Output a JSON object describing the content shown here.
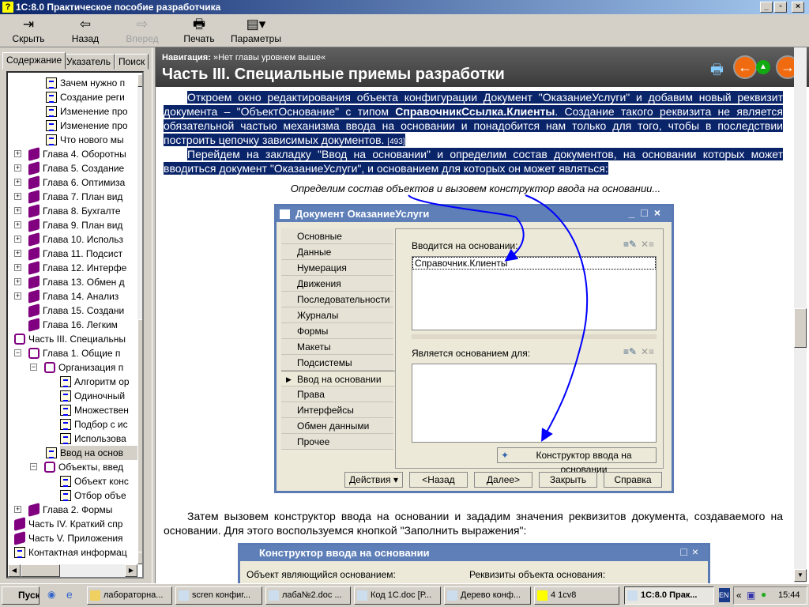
{
  "window": {
    "title": "1С:8.0  Практическое пособие разработчика"
  },
  "toolbar": [
    {
      "label": "Скрыть",
      "icon": "hide-icon"
    },
    {
      "label": "Назад",
      "icon": "back-arrow-icon"
    },
    {
      "label": "Вперед",
      "icon": "forward-arrow-icon",
      "disabled": true
    },
    {
      "label": "Печать",
      "icon": "printer-icon"
    },
    {
      "label": "Параметры",
      "icon": "options-icon"
    }
  ],
  "tabs": [
    "Содержание",
    "Указатель",
    "Поиск"
  ],
  "tree": [
    {
      "label": "Зачем нужно п",
      "type": "doc",
      "lvl": 3
    },
    {
      "label": "Создание реги",
      "type": "doc",
      "lvl": 3
    },
    {
      "label": "Изменение про",
      "type": "doc",
      "lvl": 3
    },
    {
      "label": "Изменение про",
      "type": "doc",
      "lvl": 3
    },
    {
      "label": "Что нового мы",
      "type": "doc",
      "lvl": 3
    },
    {
      "label": "Глава 4. Оборотны",
      "type": "book",
      "lvl": 1,
      "pm": "+"
    },
    {
      "label": "Глава 5. Создание",
      "type": "book",
      "lvl": 1,
      "pm": "+"
    },
    {
      "label": "Глава 6. Оптимиза",
      "type": "book",
      "lvl": 1,
      "pm": "+"
    },
    {
      "label": "Глава 7. План вид",
      "type": "book",
      "lvl": 1,
      "pm": "+"
    },
    {
      "label": "Глава 8. Бухгалте",
      "type": "book",
      "lvl": 1,
      "pm": "+"
    },
    {
      "label": "Глава 9. План вид",
      "type": "book",
      "lvl": 1,
      "pm": "+"
    },
    {
      "label": "Глава 10. Использ",
      "type": "book",
      "lvl": 1,
      "pm": "+"
    },
    {
      "label": "Глава 11. Подсист",
      "type": "book",
      "lvl": 1,
      "pm": "+"
    },
    {
      "label": "Глава 12. Интерфе",
      "type": "book",
      "lvl": 1,
      "pm": "+"
    },
    {
      "label": "Глава 13. Обмен д",
      "type": "book",
      "lvl": 1,
      "pm": "+"
    },
    {
      "label": "Глава 14. Анализ",
      "type": "book",
      "lvl": 1,
      "pm": "+"
    },
    {
      "label": "Глава 15. Создани",
      "type": "book",
      "lvl": 1
    },
    {
      "label": "Глава 16. Легким",
      "type": "book",
      "lvl": 1
    },
    {
      "label": "Часть III. Специальны",
      "type": "obook",
      "lvl": 0
    },
    {
      "label": "Глава 1. Общие п",
      "type": "obook",
      "lvl": 1,
      "pm": "−"
    },
    {
      "label": "Организация п",
      "type": "obook",
      "lvl": 2,
      "pm": "−"
    },
    {
      "label": "Алгоритм ор",
      "type": "doc",
      "lvl": 4
    },
    {
      "label": "Одиночный",
      "type": "doc",
      "lvl": 4
    },
    {
      "label": "Множествен",
      "type": "doc",
      "lvl": 4
    },
    {
      "label": "Подбор с ис",
      "type": "doc",
      "lvl": 4
    },
    {
      "label": "Использова",
      "type": "doc",
      "lvl": 4
    },
    {
      "label": "Ввод на основ",
      "type": "doc",
      "lvl": 3,
      "selected": true
    },
    {
      "label": "Объекты, введ",
      "type": "obook",
      "lvl": 2,
      "pm": "−"
    },
    {
      "label": "Объект конс",
      "type": "doc",
      "lvl": 4
    },
    {
      "label": "Отбор объе",
      "type": "doc",
      "lvl": 4
    },
    {
      "label": "Глава 2. Формы",
      "type": "book",
      "lvl": 1,
      "pm": "+"
    },
    {
      "label": "Часть IV. Краткий спр",
      "type": "book",
      "lvl": 0
    },
    {
      "label": "Часть V. Приложения",
      "type": "book",
      "lvl": 0
    },
    {
      "label": "Контактная информац",
      "type": "mail",
      "lvl": 0
    }
  ],
  "header": {
    "nav_label": "Навигация:",
    "nav_value": "»Нет главы уровнем выше«",
    "title": "Часть III. Специальные приемы разработки"
  },
  "content": {
    "p1a": "Откроем окно редактирования объекта конфигурации Документ \"ОказаниеУслуги\" и добавим новый реквизит документа – \"ОбъектОснование\" с типом ",
    "p1b": "СправочникСсылка.Клиенты",
    "p1c": ". Создание такого реквизита не является обязательной частью механизма ввода на основании и понадобится нам только для того, чтобы в последствии построить цепочку зависимых документов.",
    "p1ref": "[493]",
    "p2": "Перейдем на закладку \"Ввод на основании\" и определим состав документов, на основании которых может вводиться документ \"ОказаниеУслуги\", и основанием для которых он может являться:",
    "caption": "Определим состав объектов и вызовем конструктор ввода на основании...",
    "p3": "Затем вызовем конструктор ввода на основании и зададим значения реквизитов документа, создаваемого на основании. Для этого воспользуемся кнопкой \"Заполнить выражения\":"
  },
  "dialog": {
    "title": "Документ ОказаниеУслуги",
    "tabs": [
      "Основные",
      "Данные",
      "Нумерация",
      "Движения",
      "Последовательности",
      "Журналы",
      "Формы",
      "Макеты",
      "Подсистемы",
      "Ввод на основании",
      "Права",
      "Интерфейсы",
      "Обмен данными",
      "Прочее"
    ],
    "active_tab": "Ввод на основании",
    "list1_label": "Вводится на основании:",
    "list1_items": [
      "Справочник.Клиенты"
    ],
    "list2_label": "Является основанием для:",
    "constructor_btn": "Конструктор ввода на основании",
    "buttons": [
      "Действия",
      "<Назад",
      "Далее>",
      "Закрыть",
      "Справка"
    ]
  },
  "dialog2": {
    "title": "Конструктор ввода на основании",
    "col1": "Объект являющийся основанием:",
    "col2": "Реквизиты объекта основания:"
  },
  "taskbar": {
    "start": "Пуск",
    "tasks": [
      "лабораторна...",
      "scren конфиг...",
      "лаба№2.doc ...",
      "Код 1С.doc [Р...",
      "Дерево конф...",
      "4 1cv8",
      "1С:8.0 Прак..."
    ],
    "lang": "EN",
    "clock": "15:44"
  },
  "colors": {
    "selection": "#0a246a",
    "arrow": "#0000ff",
    "dialog_caption": "#5e7fb8"
  }
}
